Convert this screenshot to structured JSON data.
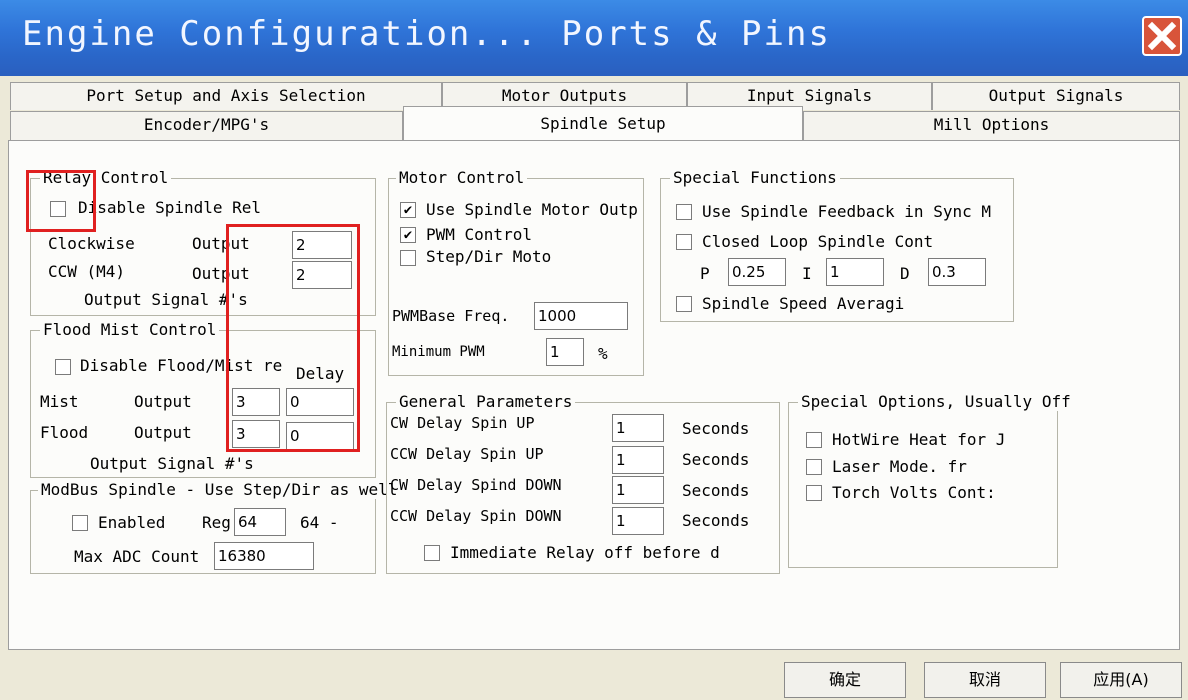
{
  "window": {
    "title": "Engine Configuration... Ports & Pins"
  },
  "tabs": {
    "row1": [
      "Port Setup and Axis Selection",
      "Motor Outputs",
      "Input Signals",
      "Output Signals"
    ],
    "row2": [
      "Encoder/MPG's",
      "Spindle Setup",
      "Mill Options"
    ],
    "active": "Spindle Setup"
  },
  "relay": {
    "legend": "Relay Control",
    "disable_label": "Disable Spindle Rel",
    "cw_label": "Clockwise",
    "ccw_label": "CCW (M4)",
    "output_label": "Output",
    "cw_value": "2",
    "ccw_value": "2",
    "signal_label": "Output Signal #'s"
  },
  "flood": {
    "legend": "Flood Mist Control",
    "disable_label": "Disable Flood/Mist re",
    "delay_label": "Delay",
    "mist_label": "Mist",
    "flood_label": "Flood",
    "output_label": "Output",
    "mist_output": "3",
    "mist_delay": "0",
    "flood_output": "3",
    "flood_delay": "0",
    "signal_label": "Output Signal #'s"
  },
  "modbus": {
    "legend": "ModBus Spindle - Use Step/Dir as well",
    "enabled_label": "Enabled",
    "reg_label": "Reg",
    "reg_value": "64",
    "reg_range": "64 -",
    "max_adc_label": "Max ADC Count",
    "max_adc_value": "16380"
  },
  "motor": {
    "legend": "Motor Control",
    "use_motor_label": "Use Spindle Motor Outp",
    "use_motor_checked": true,
    "pwm_label": "PWM Control",
    "pwm_checked": true,
    "stepdir_label": "Step/Dir Moto",
    "stepdir_checked": false,
    "pwm_base_label": "PWMBase Freq.",
    "pwm_base_value": "1000",
    "min_pwm_label": "Minimum PWM",
    "min_pwm_value": "1",
    "min_pwm_unit": "%"
  },
  "special": {
    "legend": "Special Functions",
    "feedback_label": "Use Spindle Feedback in Sync M",
    "closed_loop_label": "Closed Loop Spindle Cont",
    "p_label": "P",
    "p_value": "0.25",
    "i_label": "I",
    "i_value": "1",
    "d_label": "D",
    "d_value": "0.3",
    "averaging_label": "Spindle Speed Averagi"
  },
  "general": {
    "legend": "General Parameters",
    "rows": [
      {
        "label": "CW Delay Spin UP",
        "value": "1",
        "unit": "Seconds"
      },
      {
        "label": "CCW Delay Spin UP",
        "value": "1",
        "unit": "Seconds"
      },
      {
        "label": "CW Delay Spind DOWN",
        "value": "1",
        "unit": "Seconds"
      },
      {
        "label": "CCW Delay Spin DOWN",
        "value": "1",
        "unit": "Seconds"
      }
    ],
    "immediate_label": "Immediate Relay off before d"
  },
  "options": {
    "legend": "Special Options, Usually Off",
    "hotwire_label": "HotWire Heat for J",
    "laser_label": "Laser Mode. fr",
    "torch_label": "Torch Volts Cont:"
  },
  "buttons": {
    "ok": "确定",
    "cancel": "取消",
    "apply": "应用(A)"
  },
  "colors": {
    "title_bar": "#2f74d8",
    "close": "#d8543a",
    "highlight": "#e02020"
  }
}
